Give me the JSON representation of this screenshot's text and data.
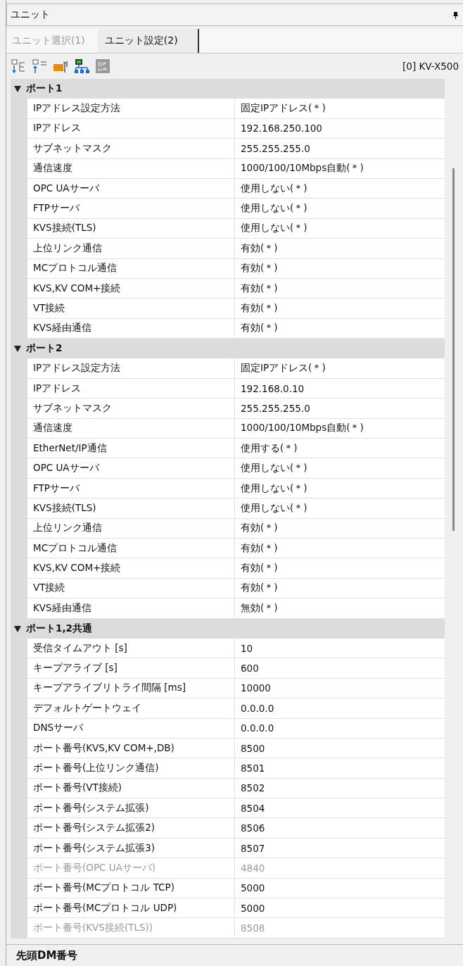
{
  "panel": {
    "title": "ユニット"
  },
  "tabs": [
    {
      "label": "ユニット選択(1)",
      "selected": false
    },
    {
      "label": "ユニット設定(2)",
      "selected": true
    }
  ],
  "toolbar": {
    "unit": "[0] KV-X500"
  },
  "sections": [
    {
      "title": "ポート1",
      "expanded": true,
      "rows": [
        {
          "name": "IPアドレス設定方法",
          "value": "固定IPアドレス(＊)",
          "disabled": false
        },
        {
          "name": "IPアドレス",
          "value": "192.168.250.100",
          "disabled": false
        },
        {
          "name": "サブネットマスク",
          "value": "255.255.255.0",
          "disabled": false
        },
        {
          "name": "通信速度",
          "value": "1000/100/10Mbps自動(＊)",
          "disabled": false
        },
        {
          "name": "OPC UAサーバ",
          "value": "使用しない(＊)",
          "disabled": false
        },
        {
          "name": "FTPサーバ",
          "value": "使用しない(＊)",
          "disabled": false
        },
        {
          "name": "KVS接続(TLS)",
          "value": "使用しない(＊)",
          "disabled": false
        },
        {
          "name": "上位リンク通信",
          "value": "有効(＊)",
          "disabled": false
        },
        {
          "name": "MCプロトコル通信",
          "value": "有効(＊)",
          "disabled": false
        },
        {
          "name": "KVS,KV COM+接続",
          "value": "有効(＊)",
          "disabled": false
        },
        {
          "name": "VT接続",
          "value": "有効(＊)",
          "disabled": false
        },
        {
          "name": "KVS経由通信",
          "value": "有効(＊)",
          "disabled": false
        }
      ]
    },
    {
      "title": "ポート2",
      "expanded": true,
      "rows": [
        {
          "name": "IPアドレス設定方法",
          "value": "固定IPアドレス(＊)",
          "disabled": false
        },
        {
          "name": "IPアドレス",
          "value": "192.168.0.10",
          "disabled": false
        },
        {
          "name": "サブネットマスク",
          "value": "255.255.255.0",
          "disabled": false
        },
        {
          "name": "通信速度",
          "value": "1000/100/10Mbps自動(＊)",
          "disabled": false
        },
        {
          "name": "EtherNet/IP通信",
          "value": "使用する(＊)",
          "disabled": false
        },
        {
          "name": "OPC UAサーバ",
          "value": "使用しない(＊)",
          "disabled": false
        },
        {
          "name": "FTPサーバ",
          "value": "使用しない(＊)",
          "disabled": false
        },
        {
          "name": "KVS接続(TLS)",
          "value": "使用しない(＊)",
          "disabled": false
        },
        {
          "name": "上位リンク通信",
          "value": "有効(＊)",
          "disabled": false
        },
        {
          "name": "MCプロトコル通信",
          "value": "有効(＊)",
          "disabled": false
        },
        {
          "name": "KVS,KV COM+接続",
          "value": "有効(＊)",
          "disabled": false
        },
        {
          "name": "VT接続",
          "value": "有効(＊)",
          "disabled": false
        },
        {
          "name": "KVS経由通信",
          "value": "無効(＊)",
          "disabled": false
        }
      ]
    },
    {
      "title": "ポート1,2共通",
      "expanded": true,
      "rows": [
        {
          "name": "受信タイムアウト [s]",
          "value": "10",
          "disabled": false
        },
        {
          "name": "キープアライブ [s]",
          "value": "600",
          "disabled": false
        },
        {
          "name": "キープアライブリトライ間隔 [ms]",
          "value": "10000",
          "disabled": false
        },
        {
          "name": "デフォルトゲートウェイ",
          "value": "0.0.0.0",
          "disabled": false
        },
        {
          "name": "DNSサーバ",
          "value": "0.0.0.0",
          "disabled": false
        },
        {
          "name": "ポート番号(KVS,KV COM+,DB)",
          "value": "8500",
          "disabled": false
        },
        {
          "name": "ポート番号(上位リンク通信)",
          "value": "8501",
          "disabled": false
        },
        {
          "name": "ポート番号(VT接続)",
          "value": "8502",
          "disabled": false
        },
        {
          "name": "ポート番号(システム拡張)",
          "value": "8504",
          "disabled": false
        },
        {
          "name": "ポート番号(システム拡張2)",
          "value": "8506",
          "disabled": false
        },
        {
          "name": "ポート番号(システム拡張3)",
          "value": "8507",
          "disabled": false
        },
        {
          "name": "ポート番号(OPC UAサーバ)",
          "value": "4840",
          "disabled": true
        },
        {
          "name": "ポート番号(MCプロトコル TCP)",
          "value": "5000",
          "disabled": false
        },
        {
          "name": "ポート番号(MCプロトコル UDP)",
          "value": "5000",
          "disabled": false
        },
        {
          "name": "ポート番号(KVS接続(TLS))",
          "value": "8508",
          "disabled": true
        }
      ]
    }
  ],
  "description": {
    "title": "先頭DM番号"
  }
}
